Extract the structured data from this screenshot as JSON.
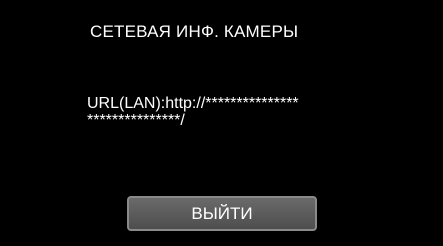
{
  "screen": {
    "title": "СЕТЕВАЯ ИНФ. КАМЕРЫ",
    "url_line1": "URL(LAN):http://***************",
    "url_line2": "***************/",
    "exit_label": "ВЫЙТИ"
  },
  "colors": {
    "background": "#000000",
    "text": "#ffffff",
    "button_fill": "#5a5a5a",
    "button_border": "#8a8a8a"
  }
}
